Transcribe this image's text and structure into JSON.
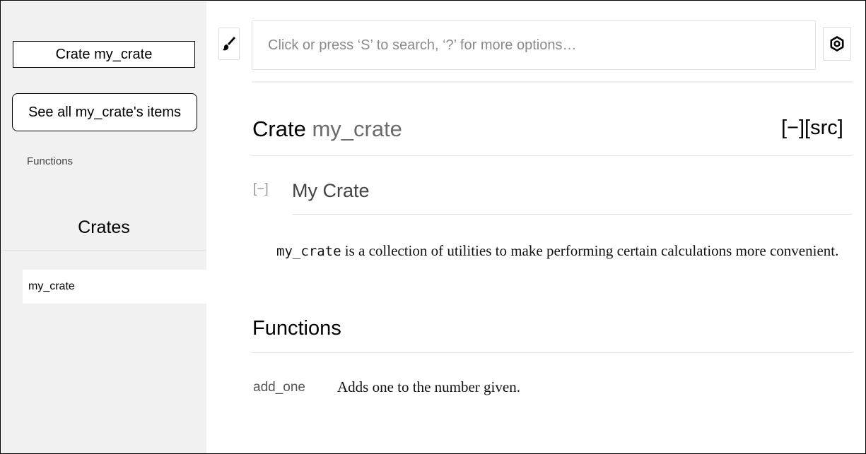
{
  "sidebar": {
    "crate_title": "Crate my_crate",
    "all_items_label": "See all my_crate's items",
    "sections": [
      "Functions"
    ],
    "crates_heading": "Crates",
    "crates": [
      "my_crate"
    ]
  },
  "search": {
    "placeholder": "Click or press ‘S’ to search, ‘?’ for more options…"
  },
  "icons": {
    "theme": "paintbrush-icon",
    "settings": "gear-icon"
  },
  "page": {
    "title_kind": "Crate",
    "title_name": "my_crate",
    "src_links": "[−][src]"
  },
  "docblock": {
    "toggle": "[−]",
    "heading": "My Crate",
    "code": "my_crate",
    "text": " is a collection of utilities to make performing certain calculations more convenient."
  },
  "functions": {
    "heading": "Functions",
    "items": [
      {
        "name": "add_one",
        "description": "Adds one to the number given."
      }
    ]
  }
}
